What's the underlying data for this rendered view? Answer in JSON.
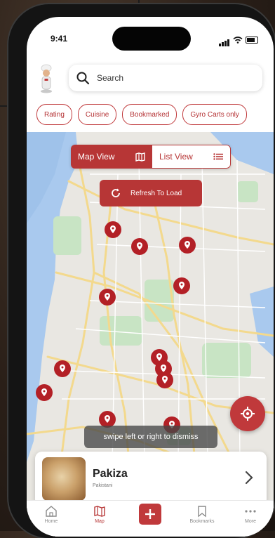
{
  "status": {
    "time": "9:41"
  },
  "search": {
    "placeholder": "Search"
  },
  "filters": [
    "Rating",
    "Cuisine",
    "Bookmarked",
    "Gyro Carts only"
  ],
  "view_toggle": {
    "map_label": "Map View",
    "list_label": "List View",
    "active": "map"
  },
  "refresh_label": "Refresh To Load",
  "toast": "swipe left or right to dismiss",
  "card": {
    "name": "Pakiza",
    "subtitle": "Pakistani"
  },
  "tabs": [
    {
      "label": "Home",
      "icon": "home-icon"
    },
    {
      "label": "Map",
      "icon": "map-icon",
      "active": true
    },
    {
      "label": "",
      "icon": "add-icon"
    },
    {
      "label": "Bookmarks",
      "icon": "bookmark-icon"
    },
    {
      "label": "More",
      "icon": "more-icon"
    }
  ],
  "colors": {
    "accent": "#b73636",
    "water": "#a9c9ee",
    "park": "#c8e4c4",
    "road": "#f3d98d"
  }
}
